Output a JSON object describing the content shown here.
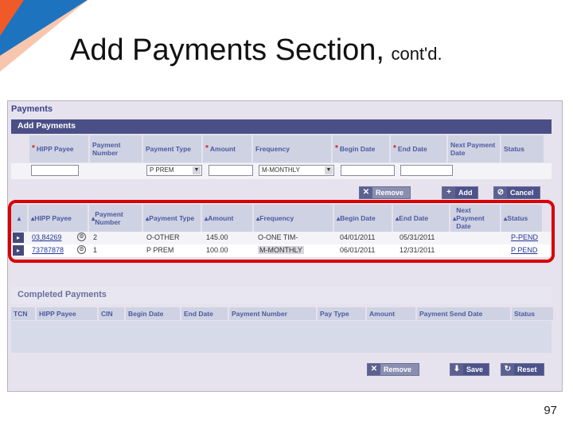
{
  "slide": {
    "title": "Add Payments Section,",
    "subtitle": "cont'd.",
    "page_number": "97"
  },
  "panel": {
    "title": "Payments",
    "add_section": "Add Payments"
  },
  "add_headers": [
    "HIPP Payee",
    "Payment Number",
    "Payment Type",
    "Amount",
    "Frequency",
    "Begin Date",
    "End Date",
    "Next Payment Date",
    "Status"
  ],
  "add_inputs": {
    "payment_type": "P PREM",
    "frequency": "M-MONTHLY"
  },
  "buttons": {
    "remove": "Remove",
    "add": "Add",
    "cancel": "Cancel",
    "remove2": "Remove",
    "save": "Save",
    "reset": "Reset"
  },
  "list_headers": [
    "HIPP Payee",
    "Payment Number",
    "Payment Type",
    "Amount",
    "Frequency",
    "Begin Date",
    "End Date",
    "Next Payment Date",
    "Status"
  ],
  "rows": [
    {
      "payee": "03,84269",
      "number": "2",
      "type": "O-OTHER",
      "amount": "145.00",
      "frequency": "O-ONE TIM-",
      "begin": "04/01/2011",
      "end": "05/31/2011",
      "status": "P-PEND"
    },
    {
      "payee": "73787878",
      "number": "1",
      "type": "P PREM",
      "amount": "100.00",
      "frequency": "M-MONTHLY",
      "begin": "06/01/2011",
      "end": "12/31/2011",
      "status": "P PEND"
    }
  ],
  "completed": {
    "title": "Completed Payments",
    "headers": [
      "TCN",
      "HIPP Payee",
      "CIN",
      "Begin Date",
      "End Date",
      "Payment Number",
      "Pay Type",
      "Amount",
      "Payment Send Date",
      "Status"
    ]
  },
  "colors": {
    "corner_orange": "#f05a28",
    "corner_blue": "#1e73be",
    "highlight": "#d80000",
    "bar": "#4b4f87"
  }
}
